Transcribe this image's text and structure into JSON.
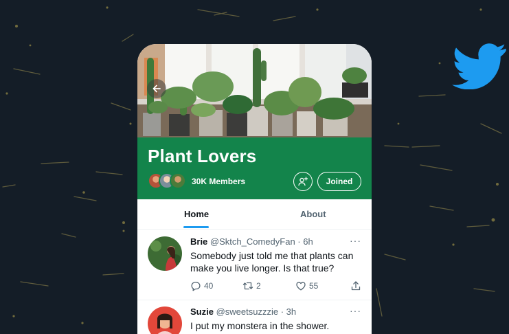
{
  "brand": {
    "logo": "twitter-bird-icon",
    "color": "#1d9bf0"
  },
  "community": {
    "title": "Plant Lovers",
    "members": "30K Members",
    "joined_label": "Joined",
    "header_color": "#13844b"
  },
  "tabs": [
    {
      "label": "Home",
      "active": true
    },
    {
      "label": "About",
      "active": false
    }
  ],
  "tweets": [
    {
      "name": "Brie",
      "handle": "@Sktch_ComedyFan · 6h",
      "text": "Somebody just told me that plants can make you live longer. Is that true?",
      "replies": "40",
      "retweets": "2",
      "likes": "55"
    },
    {
      "name": "Suzie",
      "handle": "@sweetsuzzzie · 3h",
      "text": "I put my monstera in the shower."
    }
  ],
  "more_glyph": "···"
}
